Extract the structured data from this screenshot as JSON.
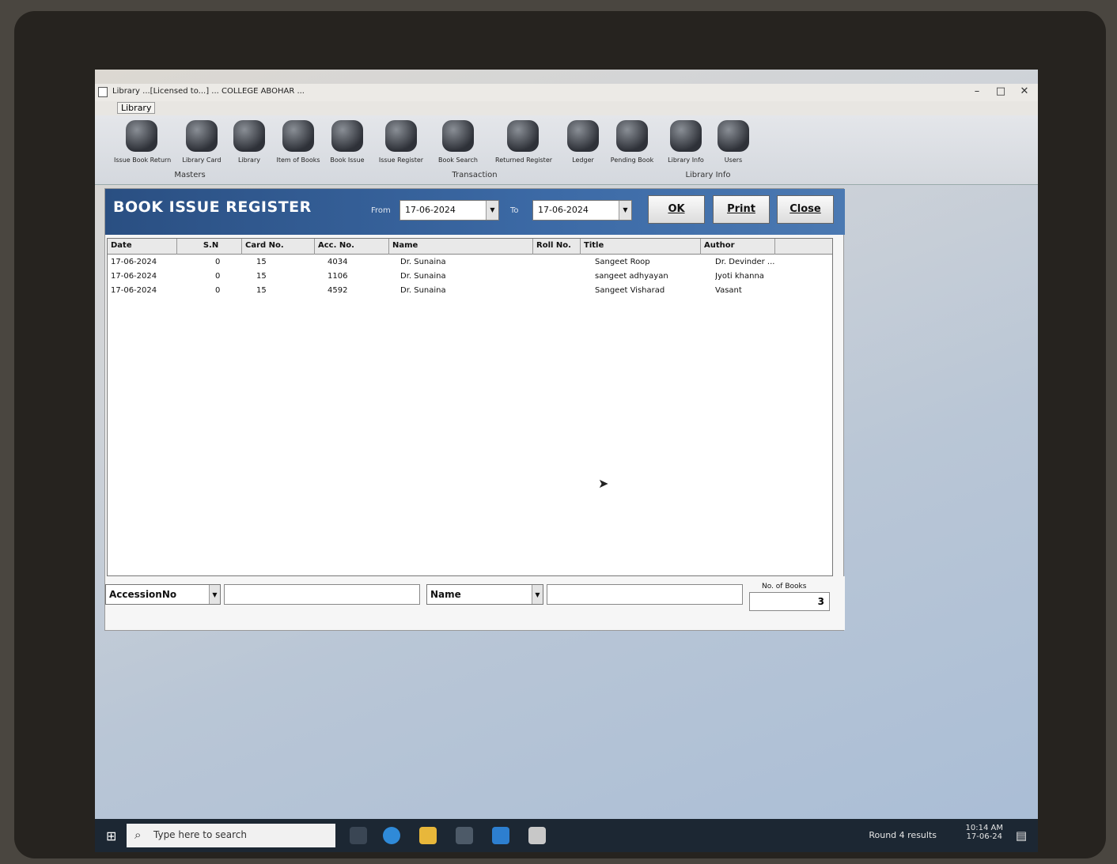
{
  "window": {
    "title": "Library ...[Licensed to...] ... COLLEGE ABOHAR ...",
    "menu_library": "Library",
    "minimize": "–",
    "maximize": "□",
    "close": "✕"
  },
  "ribbon": {
    "buttons": [
      "Issue Book Return",
      "Library Card",
      "Library",
      "Item of Books",
      "Book Issue",
      "Issue Register",
      "Book Search",
      "Returned Register",
      "Ledger",
      "Pending Book",
      "Library Info",
      "Users"
    ],
    "groups": [
      "Masters",
      "Transaction",
      "Library Info"
    ]
  },
  "form": {
    "title": "BOOK ISSUE REGISTER",
    "from_label": "From",
    "to_label": "To",
    "from_date": "17-06-2024",
    "to_date": "17-06-2024",
    "ok_label": "OK",
    "print_label": "Print",
    "close_label": "Close"
  },
  "grid": {
    "columns": [
      "Date",
      "S.N",
      "Card No.",
      "Acc. No.",
      "Name",
      "Roll No.",
      "Title",
      "Author"
    ],
    "rows": [
      [
        "17-06-2024",
        "0",
        "15",
        "4034",
        "Dr. Sunaina",
        "",
        "Sangeet Roop",
        "Dr. Devinder ..."
      ],
      [
        "17-06-2024",
        "0",
        "15",
        "1106",
        "Dr. Sunaina",
        "",
        "sangeet adhyayan",
        "Jyoti khanna"
      ],
      [
        "17-06-2024",
        "0",
        "15",
        "4592",
        "Dr. Sunaina",
        "",
        "Sangeet Visharad",
        "Vasant"
      ]
    ]
  },
  "filter": {
    "field1": "AccessionNo",
    "field2": "Name",
    "no_of_books_label": "No. of Books",
    "no_of_books": "3"
  },
  "taskbar": {
    "search_placeholder": "Type here to search",
    "tray_text": "Round 4 results",
    "clock_time": "10:14 AM",
    "clock_date": "17-06-24"
  }
}
